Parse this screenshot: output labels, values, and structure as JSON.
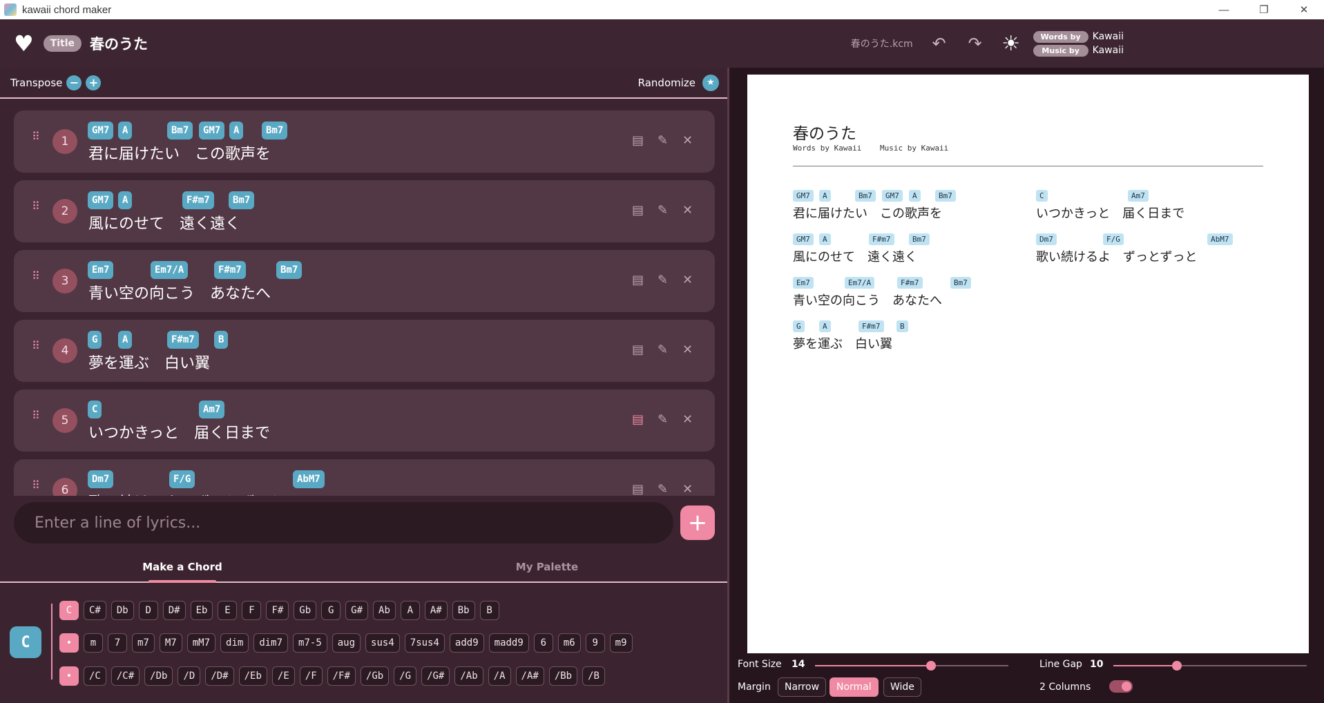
{
  "window": {
    "title": "kawaii chord maker"
  },
  "header": {
    "title_chip": "Title",
    "song_title": "春のうた",
    "filename": "春のうた.kcm",
    "words_label": "Words by",
    "words_value": "Kawaii",
    "music_label": "Music by",
    "music_value": "Kawaii"
  },
  "toolbar": {
    "transpose": "Transpose",
    "minus": "−",
    "plus": "+",
    "randomize": "Randomize"
  },
  "lines": [
    {
      "num": "1",
      "lyric": "君に届けたい　この歌声を",
      "chords": [
        "GM7",
        "A",
        "Bm7",
        "GM7",
        "A",
        "Bm7"
      ]
    },
    {
      "num": "2",
      "lyric": "風にのせて　遠く遠く",
      "chords": [
        "GM7",
        "A",
        "F#m7",
        "Bm7"
      ]
    },
    {
      "num": "3",
      "lyric": "青い空の向こう　あなたへ",
      "chords": [
        "Em7",
        "Em7/A",
        "F#m7",
        "Bm7"
      ]
    },
    {
      "num": "4",
      "lyric": "夢を運ぶ　白い翼",
      "chords": [
        "G",
        "A",
        "F#m7",
        "B"
      ]
    },
    {
      "num": "5",
      "lyric": "いつかきっと　届く日まで",
      "chords": [
        "C",
        "Am7"
      ]
    },
    {
      "num": "6",
      "lyric": "歌い続けるよ　ずっとずっと",
      "chords": [
        "Dm7",
        "F/G",
        "AbM7"
      ]
    }
  ],
  "input": {
    "placeholder": "Enter a line of lyrics...",
    "add": "+"
  },
  "tabs": {
    "make": "Make a Chord",
    "palette": "My Palette"
  },
  "builder": {
    "current": "C",
    "roots": [
      "C",
      "C#",
      "Db",
      "D",
      "D#",
      "Eb",
      "E",
      "F",
      "F#",
      "Gb",
      "G",
      "G#",
      "Ab",
      "A",
      "A#",
      "Bb",
      "B"
    ],
    "qualities": [
      "•",
      "m",
      "7",
      "m7",
      "M7",
      "mM7",
      "dim",
      "dim7",
      "m7-5",
      "aug",
      "sus4",
      "7sus4",
      "add9",
      "madd9",
      "6",
      "m6",
      "9",
      "m9"
    ],
    "bass": [
      "•",
      "/C",
      "/C#",
      "/Db",
      "/D",
      "/D#",
      "/Eb",
      "/E",
      "/F",
      "/F#",
      "/Gb",
      "/G",
      "/G#",
      "/Ab",
      "/A",
      "/A#",
      "/Bb",
      "/B"
    ]
  },
  "preview": {
    "title": "春のうた",
    "words": "Words by Kawaii",
    "music": "Music by Kawaii"
  },
  "controls": {
    "font_size_label": "Font Size",
    "font_size": "14",
    "font_size_frac": 0.6,
    "line_gap_label": "Line Gap",
    "line_gap": "10",
    "line_gap_frac": 0.33,
    "margin_label": "Margin",
    "narrow": "Narrow",
    "normal": "Normal",
    "wide": "Wide",
    "columns_label": "2 Columns"
  },
  "colors": {
    "accent": "#f08aa4",
    "chord": "#5aa9c4",
    "preview_chord": "#bfe3f2"
  }
}
